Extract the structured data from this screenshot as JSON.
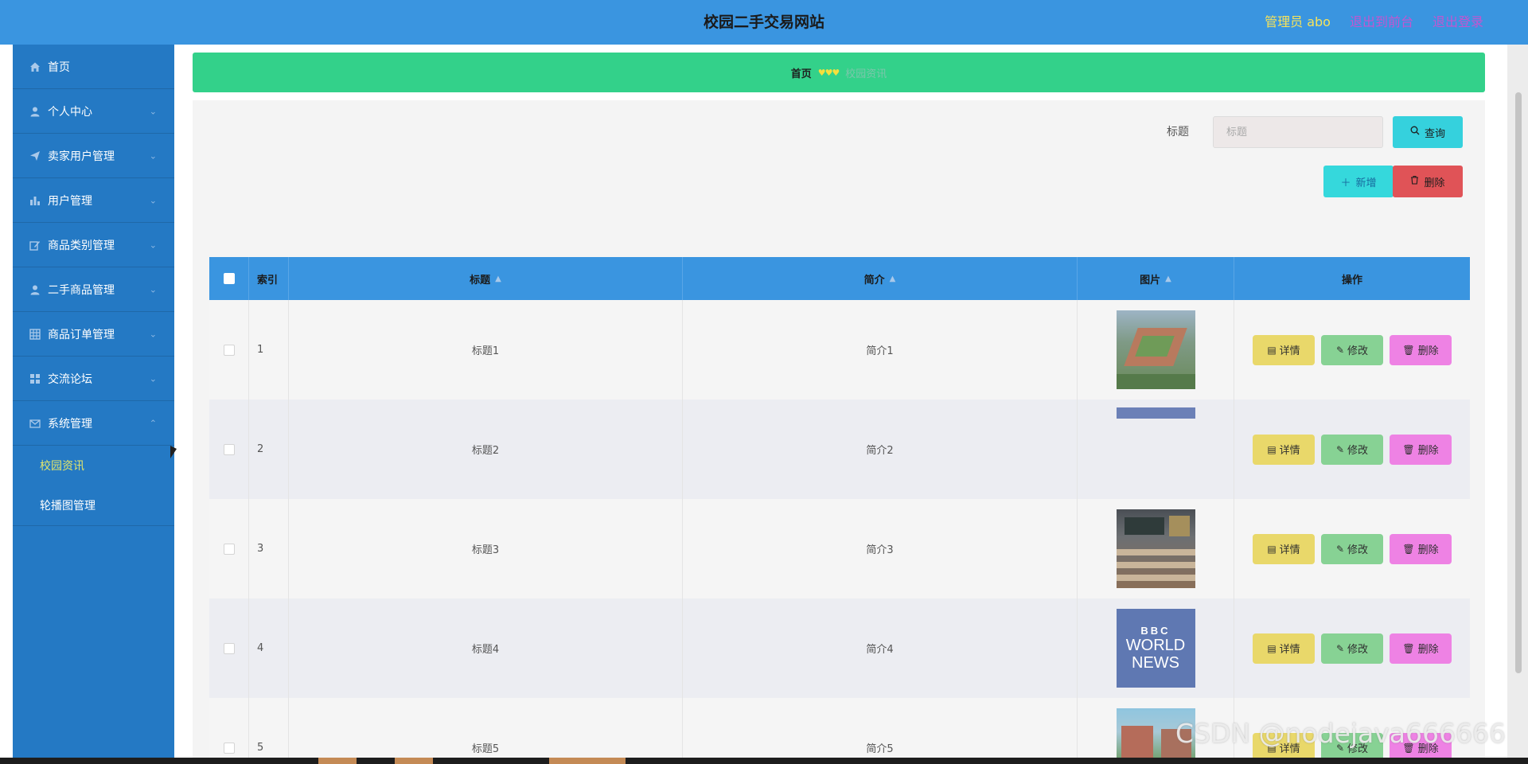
{
  "header": {
    "title": "校园二手交易网站",
    "user_label": "管理员 abo",
    "to_front_label": "退出到前台",
    "logout_label": "退出登录"
  },
  "sidebar": {
    "items": [
      {
        "label": "首页",
        "icon": "home-icon"
      },
      {
        "label": "个人中心",
        "icon": "user-icon"
      },
      {
        "label": "卖家用户管理",
        "icon": "send-icon"
      },
      {
        "label": "用户管理",
        "icon": "bar-chart-icon"
      },
      {
        "label": "商品类别管理",
        "icon": "edit-icon"
      },
      {
        "label": "二手商品管理",
        "icon": "user-icon"
      },
      {
        "label": "商品订单管理",
        "icon": "grid-icon"
      },
      {
        "label": "交流论坛",
        "icon": "apps-icon"
      },
      {
        "label": "系统管理",
        "icon": "mail-icon"
      }
    ],
    "submenu": [
      {
        "label": "校园资讯",
        "active": true
      },
      {
        "label": "轮播图管理",
        "active": false
      }
    ]
  },
  "breadcrumb": {
    "home": "首页",
    "separator": "♥♥♥",
    "current": "校园资讯"
  },
  "search": {
    "label": "标题",
    "placeholder": "标题",
    "query_label": "查询"
  },
  "actions": {
    "add_label": "新增",
    "delete_label": "删除"
  },
  "table": {
    "columns": [
      "索引",
      "标题",
      "简介",
      "图片",
      "操作"
    ],
    "rows": [
      {
        "index": "1",
        "title": "标题1",
        "intro": "简介1",
        "image": "campus-aerial"
      },
      {
        "index": "2",
        "title": "标题2",
        "intro": "简介2",
        "image": "blank-banner"
      },
      {
        "index": "3",
        "title": "标题3",
        "intro": "简介3",
        "image": "classroom"
      },
      {
        "index": "4",
        "title": "标题4",
        "intro": "简介4",
        "image": "bbc-world-news"
      },
      {
        "index": "5",
        "title": "标题5",
        "intro": "简介5",
        "image": "campus-garden"
      }
    ],
    "row_actions": {
      "detail_label": "详情",
      "edit_label": "修改",
      "delete_label": "删除"
    }
  },
  "thumb_text": {
    "bbc": "BBC",
    "world": "WORLD",
    "news": "NEWS"
  },
  "watermark": "CSDN @nodejava666666",
  "colors": {
    "header_bg": "#3a95e0",
    "sidebar_bg": "#2479c4",
    "breadcrumb_bg": "#33d18a",
    "active_submenu": "#e4e66a",
    "btn_detail": "#e9d86a",
    "btn_edit": "#87d294",
    "btn_delete": "#ee82e4",
    "btn_bulk_delete": "#e05357",
    "btn_add": "#35d8dc"
  }
}
